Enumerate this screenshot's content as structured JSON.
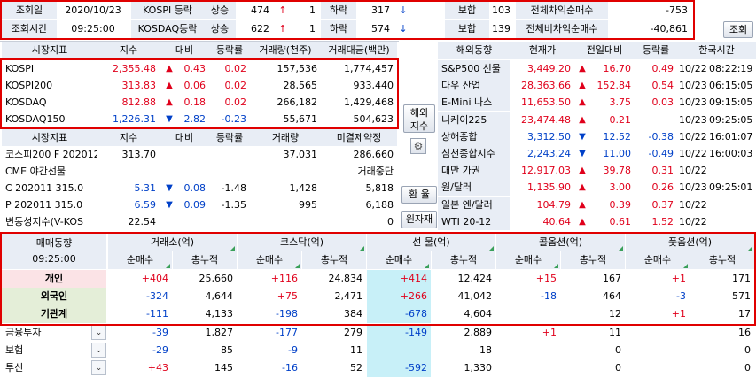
{
  "top": {
    "row1": {
      "lbl_date": "조회일",
      "date": "2020/10/23",
      "kospi_lbl": "KOSPI 등락",
      "up_lbl": "상승",
      "up_cnt": "474",
      "up_arrow": "↑",
      "up_limit": "1",
      "down_lbl": "하락",
      "down_cnt": "317",
      "down_arrow": "↓",
      "flat_lbl": "보합",
      "flat_cnt": "103",
      "arb_lbl": "전체차익순매수",
      "arb_val": "-753"
    },
    "row2": {
      "lbl_time": "조회시간",
      "time": "09:25:00",
      "kosdaq_lbl": "KOSDAQ등락",
      "up_lbl": "상승",
      "up_cnt": "622",
      "up_arrow": "↑",
      "up_limit": "1",
      "down_lbl": "하락",
      "down_cnt": "574",
      "down_arrow": "↓",
      "flat_lbl": "보합",
      "flat_cnt": "139",
      "nonarb_lbl": "전체비차익순매수",
      "nonarb_val": "-40,861"
    },
    "query_button": "조회"
  },
  "market": {
    "headers": [
      "시장지표",
      "지수",
      "대비",
      "등락률",
      "거래량(천주)",
      "거래대금(백만)"
    ],
    "rows": [
      {
        "name": "KOSPI",
        "index": "2,355.48",
        "arrow": "▲",
        "diff": "0.43",
        "rate": "0.02",
        "volume": "157,536",
        "amount": "1,774,457"
      },
      {
        "name": "KOSPI200",
        "index": "313.83",
        "arrow": "▲",
        "diff": "0.06",
        "rate": "0.02",
        "volume": "28,565",
        "amount": "933,440"
      },
      {
        "name": "KOSDAQ",
        "index": "812.88",
        "arrow": "▲",
        "diff": "0.18",
        "rate": "0.02",
        "volume": "266,182",
        "amount": "1,429,468"
      },
      {
        "name": "KOSDAQ150",
        "index": "1,226.31",
        "arrow": "▼",
        "diff": "2.82",
        "rate": "-0.23",
        "volume": "55,671",
        "amount": "504,623"
      }
    ],
    "headers2": [
      "시장지표",
      "지수",
      "대비",
      "등락률",
      "거래량",
      "미결제약정"
    ],
    "rows2": [
      {
        "name": "코스피200 F 202012",
        "index": "313.70",
        "arrow": "",
        "diff": "",
        "rate": "",
        "volume": "37,031",
        "oi": "286,660"
      },
      {
        "name": "CME 야간선물",
        "index": "",
        "arrow": "",
        "diff": "",
        "rate": "",
        "volume": "",
        "oi": "거래중단"
      },
      {
        "name": "C 202011 315.0",
        "index": "5.31",
        "arrow": "▼",
        "diff": "0.08",
        "rate": "-1.48",
        "volume": "1,428",
        "oi": "5,818"
      },
      {
        "name": "P 202011 315.0",
        "index": "6.59",
        "arrow": "▼",
        "diff": "0.09",
        "rate": "-1.35",
        "volume": "995",
        "oi": "6,188"
      },
      {
        "name": "변동성지수(V-KOS",
        "index": "22.54",
        "arrow": "",
        "diff": "",
        "rate": "",
        "volume": "",
        "oi": "0"
      }
    ]
  },
  "side_buttons": {
    "overseas_line1": "해외",
    "overseas_line2": "지수",
    "fx_line1": "환",
    "fx_line2": "율",
    "raw": "원자재"
  },
  "overseas": {
    "headers": [
      "해외동향",
      "현재가",
      "전일대비",
      "등락률",
      "한국시간"
    ],
    "rows": [
      {
        "name": "S&P500 선물",
        "price": "3,449.20",
        "arrow": "▲",
        "diff": "16.70",
        "rate": "0.49",
        "date": "10/22",
        "time": "08:22:19"
      },
      {
        "name": "다우 산업",
        "price": "28,363.66",
        "arrow": "▲",
        "diff": "152.84",
        "rate": "0.54",
        "date": "10/23",
        "time": "06:15:05"
      },
      {
        "name": "E-Mini 나스",
        "price": "11,653.50",
        "arrow": "▲",
        "diff": "3.75",
        "rate": "0.03",
        "date": "10/23",
        "time": "09:15:05"
      },
      {
        "name": "니케이225",
        "price": "23,474.48",
        "arrow": "▲",
        "diff": "0.21",
        "rate": "",
        "date": "10/23",
        "time": "09:25:05"
      },
      {
        "name": "상해종합",
        "price": "3,312.50",
        "arrow": "▼",
        "diff": "12.52",
        "rate": "-0.38",
        "date": "10/22",
        "time": "16:01:07"
      },
      {
        "name": "심천종합지수",
        "price": "2,243.24",
        "arrow": "▼",
        "diff": "11.00",
        "rate": "-0.49",
        "date": "10/22",
        "time": "16:00:03"
      },
      {
        "name": "대만 가권",
        "price": "12,917.03",
        "arrow": "▲",
        "diff": "39.78",
        "rate": "0.31",
        "date": "10/22",
        "time": ""
      },
      {
        "name": "원/달러",
        "price": "1,135.90",
        "arrow": "▲",
        "diff": "3.00",
        "rate": "0.26",
        "date": "10/23",
        "time": "09:25:01"
      },
      {
        "name": "일본 엔/달러",
        "price": "104.79",
        "arrow": "▲",
        "diff": "0.39",
        "rate": "0.37",
        "date": "10/22",
        "time": ""
      },
      {
        "name": "WTI 20-12",
        "price": "40.64",
        "arrow": "▲",
        "diff": "0.61",
        "rate": "1.52",
        "date": "10/22",
        "time": ""
      }
    ]
  },
  "trade": {
    "corner_title": "매매동향",
    "corner_time": "09:25:00",
    "groups": [
      "거래소(억)",
      "코스닥(억)",
      "선   물(억)",
      "콜옵션(억)",
      "풋옵션(억)"
    ],
    "subheaders": [
      "순매수",
      "총누적"
    ],
    "rows": [
      {
        "name": "개인",
        "vals": [
          "+404",
          "25,660",
          "+116",
          "24,834",
          "+414",
          "12,424",
          "+15",
          "167",
          "+1",
          "171"
        ]
      },
      {
        "name": "외국인",
        "vals": [
          "-324",
          "4,644",
          "+75",
          "2,471",
          "+266",
          "41,042",
          "-18",
          "464",
          "-3",
          "571"
        ]
      },
      {
        "name": "기관계",
        "vals": [
          "-111",
          "4,133",
          "-198",
          "384",
          "-678",
          "4,604",
          "",
          "12",
          "+1",
          "17"
        ]
      },
      {
        "name": "금융투자",
        "vals": [
          "-39",
          "1,827",
          "-177",
          "279",
          "-149",
          "2,889",
          "+1",
          "11",
          "",
          "16"
        ]
      },
      {
        "name": "보험",
        "vals": [
          "-29",
          "85",
          "-9",
          "11",
          "",
          "18",
          "",
          "0",
          "",
          "0"
        ]
      },
      {
        "name": "투신",
        "vals": [
          "+43",
          "145",
          "-16",
          "52",
          "-592",
          "1,330",
          "",
          "0",
          "",
          "0"
        ]
      }
    ]
  },
  "colors": {
    "label_bg": "#e8edf5",
    "up": "#e0001b",
    "down": "#0040c8",
    "highlight_red": "#e00000",
    "pink": "#fbe3e6",
    "green": "#e4eed8",
    "cyan": "#c8f0f8"
  }
}
